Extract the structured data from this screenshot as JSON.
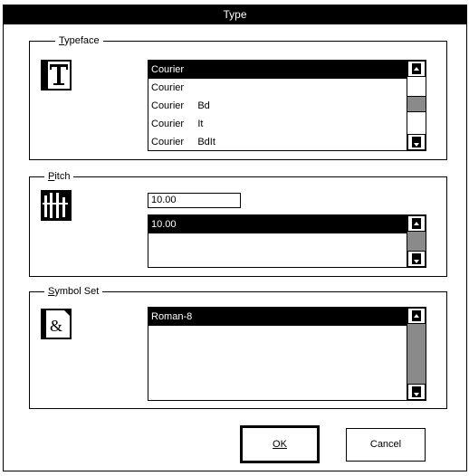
{
  "dialog": {
    "title": "Type"
  },
  "typeface": {
    "label": "Typeface",
    "icon": "typeface-icon",
    "items": [
      "Courier",
      "Courier",
      "Courier     Bd",
      "Courier     It",
      "Courier     BdIt"
    ],
    "selected_index": 0
  },
  "pitch": {
    "label": "Pitch",
    "icon": "pitch-icon",
    "value": "10.00",
    "items": [
      "10.00"
    ],
    "selected_index": 0
  },
  "symbol_set": {
    "label": "Symbol Set",
    "icon": "symbol-set-icon",
    "items": [
      "Roman-8"
    ],
    "selected_index": 0
  },
  "buttons": {
    "ok": "OK",
    "cancel": "Cancel"
  }
}
